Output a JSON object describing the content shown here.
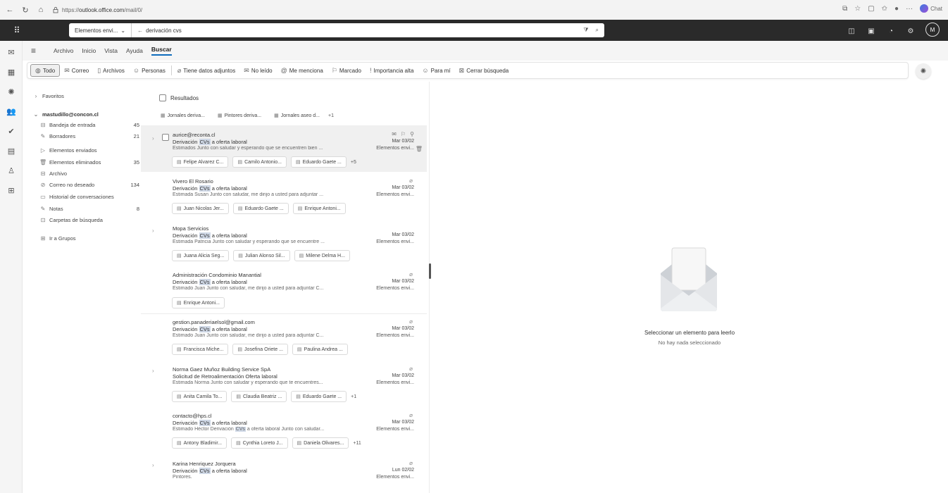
{
  "browser": {
    "url_prefix": "https://",
    "url_domain": "outlook.office.com",
    "url_path": "/mail/0/",
    "chat_label": "Chat"
  },
  "search": {
    "scope": "Elementos envi...",
    "term": "derivación cvs"
  },
  "account_avatar": "M",
  "menu": {
    "tabs": [
      "Archivo",
      "Inicio",
      "Vista",
      "Ayuda",
      "Buscar"
    ],
    "active_tab": "Buscar"
  },
  "filters": [
    "Todo",
    "Correo",
    "Archivos",
    "Personas",
    "Tiene datos adjuntos",
    "No leído",
    "Me menciona",
    "Marcado",
    "Importancia alta",
    "Para mí",
    "Cerrar búsqueda"
  ],
  "folders": {
    "favorites": "Favoritos",
    "account": "mastudillo@concon.cl",
    "items": [
      {
        "label": "Bandeja de entrada",
        "count": "45",
        "icon": "inbox-icon"
      },
      {
        "label": "Borradores",
        "count": "21",
        "icon": "drafts-icon"
      },
      {
        "label": "Elementos enviados",
        "count": "",
        "icon": "sent-icon"
      },
      {
        "label": "Elementos eliminados",
        "count": "35",
        "icon": "trash-icon"
      },
      {
        "label": "Archivo",
        "count": "",
        "icon": "archive-icon"
      },
      {
        "label": "Correo no deseado",
        "count": "134",
        "icon": "junk-icon"
      },
      {
        "label": "Historial de conversaciones",
        "count": "",
        "icon": "history-icon"
      },
      {
        "label": "Notas",
        "count": "8",
        "icon": "notes-icon"
      },
      {
        "label": "Carpetas de búsqueda",
        "count": "",
        "icon": "search-folder-icon"
      }
    ],
    "groups": "Ir a Grupos"
  },
  "results": {
    "header": "Resultados",
    "top_attachments": [
      "Jornales deriva...",
      "Pintores deriva...",
      "Jornales aseo d..."
    ],
    "top_more": "+1"
  },
  "messages": [
    {
      "sender": "aurice@reconta.cl",
      "subject_pre": "Derivación ",
      "subject_hl": "CVs",
      "subject_post": " a oferta laboral",
      "date": "Mar 03/02",
      "preview": "Estimados Junto con saludar y esperando que se encuentren bien ...",
      "folder": "Elementos envi...",
      "attachments": [
        "Felipe Alvarez C...",
        "Camilo Antonio...",
        "Eduardo Gaete ..."
      ],
      "more": "+5"
    },
    {
      "sender": "Vivero El Rosario",
      "subject_pre": "Derivación ",
      "subject_hl": "CVs",
      "subject_post": " a oferta laboral",
      "date": "Mar 03/02",
      "preview": "Estimada Susan Junto con saludar, me dirijo a usted para adjuntar ...",
      "folder": "Elementos envi...",
      "attachments": [
        "Juan Nicolas Jer...",
        "Eduardo Gaete ...",
        "Enrique Antoni..."
      ],
      "more": ""
    },
    {
      "sender": "Mopa Servicios",
      "subject_pre": "Derivación ",
      "subject_hl": "CVs",
      "subject_post": " a oferta laboral",
      "date": "Mar 03/02",
      "preview": "Estimada Patricia Junto con saludar y esperando que se encuentre ...",
      "folder": "Elementos envi...",
      "attachments": [
        "Juana Alicia Seg...",
        "Julian Alonso Sil...",
        "Milene Delma H..."
      ],
      "more": ""
    },
    {
      "sender": "Administración Condominio Manantial",
      "subject_pre": "Derivación ",
      "subject_hl": "CVs",
      "subject_post": " a oferta laboral",
      "date": "Mar 03/02",
      "preview": "Estimado Juan Junto con saludar, me dirijo a usted para adjuntar C...",
      "folder": "Elementos envi...",
      "attachments": [
        "Enrique Antoni..."
      ],
      "more": ""
    },
    {
      "sender": "gestion.panaderiaelsol@gmail.com",
      "subject_pre": "Derivación ",
      "subject_hl": "CVs",
      "subject_post": " a oferta laboral",
      "date": "Mar 03/02",
      "preview": "Estimado Juan Junto con saludar, me dirijo a usted para adjuntar C...",
      "folder": "Elementos envi...",
      "attachments": [
        "Francisca Miche...",
        "Josefina Oriete ...",
        "Paulina Andrea ..."
      ],
      "more": ""
    },
    {
      "sender": "Norma Gaez Muñoz Building Service SpA",
      "subject_pre": "Solicitud de Retroalimentación Oferta laboral",
      "subject_hl": "",
      "subject_post": "",
      "date": "Mar 03/02",
      "preview": "Estimada Norma Junto con saludar y esperando que te encuentres...",
      "folder": "Elementos envi...",
      "attachments": [
        "Anita Camila To...",
        "Claudia Beatriz ...",
        "Eduardo Gaete ..."
      ],
      "more": "+1"
    },
    {
      "sender": "contacto@hps.cl",
      "subject_pre": "Derivación ",
      "subject_hl": "CVs",
      "subject_post": " a oferta laboral",
      "date": "Mar 03/02",
      "preview_pre": "Estimado Héctor Derivación ",
      "preview_hl": "CVs",
      "preview_post": " a oferta laboral Junto con saludar...",
      "folder": "Elementos envi...",
      "attachments": [
        "Antony Bladimir...",
        "Cynthia Loreto J...",
        "Daniela Olivares..."
      ],
      "more": "+11"
    },
    {
      "sender": "Karina Henriquez Jorquera",
      "subject_pre": "Derivación ",
      "subject_hl": "CVs",
      "subject_post": " a oferta laboral",
      "date": "Lun 02/02",
      "preview": "Pintores.",
      "folder": "Elementos envi...",
      "attachments": [],
      "more": ""
    }
  ],
  "reading_pane": {
    "title": "Seleccionar un elemento para leerlo",
    "subtitle": "No hay nada seleccionado"
  }
}
